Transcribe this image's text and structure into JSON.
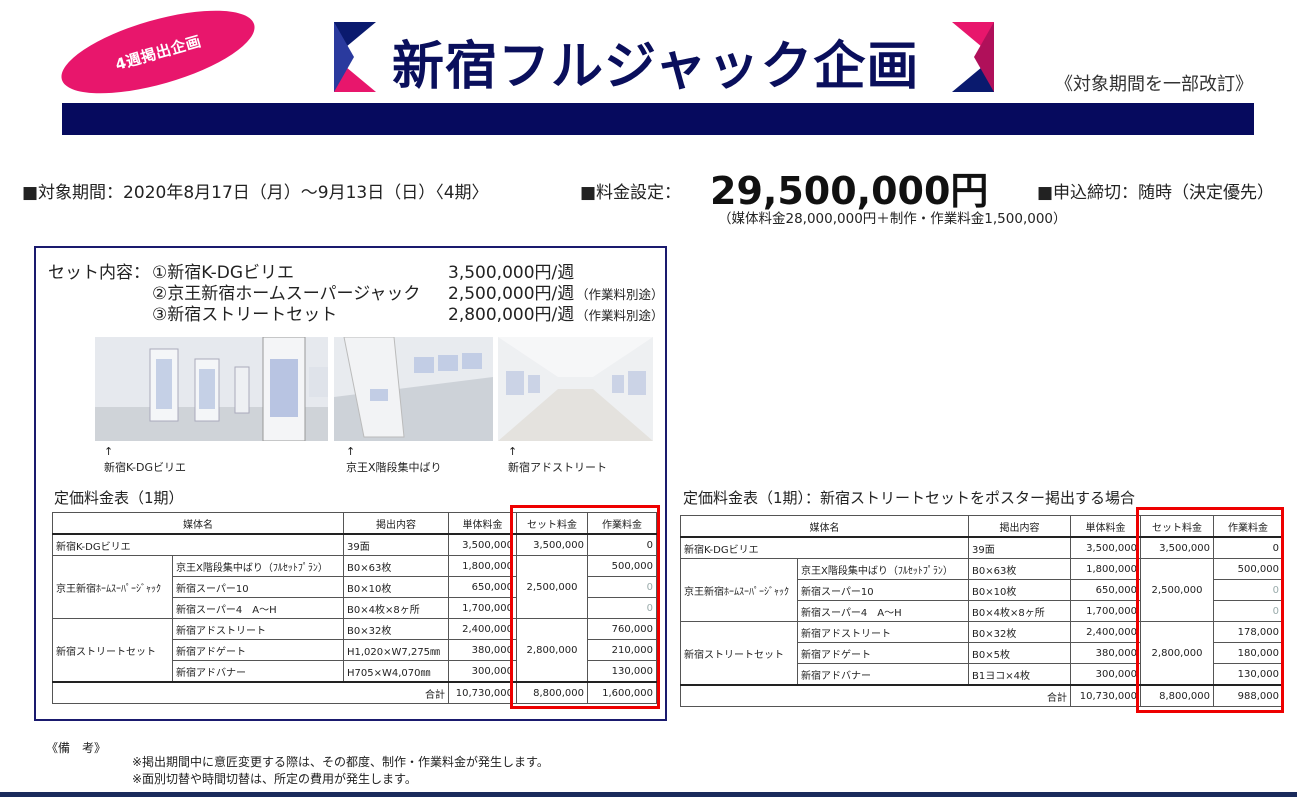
{
  "header": {
    "badge": "4週掲出企画",
    "title": "新宿フルジャック企画",
    "revision": "《対象期間を一部改訂》"
  },
  "info": {
    "period": "■対象期間：2020年8月17日（月）～9月13日（日）〈4期〉",
    "price_label": "■料金設定：",
    "price": "29,500,000円",
    "price_note": "（媒体料金28,000,000円＋制作・作業料金1,500,000）",
    "deadline": "■申込締切：随時（決定優先）"
  },
  "set": {
    "label": "セット内容：",
    "items": [
      {
        "name": "①新宿K-DGビリエ",
        "price": "3,500,000円/週",
        "note": ""
      },
      {
        "name": "②京王新宿ホームスーパージャック",
        "price": "2,500,000円/週",
        "note": "（作業料別途）"
      },
      {
        "name": "③新宿ストリートセット",
        "price": "2,800,000円/週",
        "note": "（作業料別途）"
      }
    ]
  },
  "photos": [
    {
      "caption": "新宿K-DGビリエ"
    },
    {
      "caption": "京王X階段集中ばり"
    },
    {
      "caption": "新宿アドストリート"
    }
  ],
  "arrow": "↑",
  "table1": {
    "title": "定価料金表（1期）",
    "headers": [
      "媒体名",
      "掲出内容",
      "単体料金",
      "セット料金",
      "作業料金"
    ],
    "rows": [
      {
        "group": "新宿K-DGビリエ",
        "sub": "",
        "content": "39面",
        "unit": "3,500,000",
        "set": "3,500,000",
        "work": "0"
      },
      {
        "group": "京王新宿ﾎｰﾑｽｰﾊﾟｰｼﾞｬｯｸ",
        "sub": "京王X階段集中ばり（ﾌﾙｾｯﾄﾌﾟﾗﾝ）",
        "content": "B0×63枚",
        "unit": "1,800,000",
        "set": "2,500,000",
        "work": "500,000"
      },
      {
        "sub": "新宿スーパー10",
        "content": "B0×10枚",
        "unit": "650,000",
        "work": "0"
      },
      {
        "sub": "新宿スーパー4　A～H",
        "content": "B0×4枚×8ヶ所",
        "unit": "1,700,000",
        "work": "0"
      },
      {
        "group": "新宿ストリートセット",
        "sub": "新宿アドストリート",
        "content": "B0×32枚",
        "unit": "2,400,000",
        "set": "2,800,000",
        "work": "760,000"
      },
      {
        "sub": "新宿アドゲート",
        "content": "H1,020×W7,275㎜",
        "unit": "380,000",
        "work": "210,000"
      },
      {
        "sub": "新宿アドバナー",
        "content": "H705×W4,070㎜",
        "unit": "300,000",
        "work": "130,000"
      }
    ],
    "total": {
      "label": "合計",
      "unit": "10,730,000",
      "set": "8,800,000",
      "work": "1,600,000"
    }
  },
  "table2": {
    "title": "定価料金表（1期）：新宿ストリートセットをポスター掲出する場合",
    "headers": [
      "媒体名",
      "掲出内容",
      "単体料金",
      "セット料金",
      "作業料金"
    ],
    "rows": [
      {
        "group": "新宿K-DGビリエ",
        "sub": "",
        "content": "39面",
        "unit": "3,500,000",
        "set": "3,500,000",
        "work": "0"
      },
      {
        "group": "京王新宿ﾎｰﾑｽｰﾊﾟｰｼﾞｬｯｸ",
        "sub": "京王X階段集中ばり（ﾌﾙｾｯﾄﾌﾟﾗﾝ）",
        "content": "B0×63枚",
        "unit": "1,800,000",
        "set": "2,500,000",
        "work": "500,000"
      },
      {
        "sub": "新宿スーパー10",
        "content": "B0×10枚",
        "unit": "650,000",
        "work": "0"
      },
      {
        "sub": "新宿スーパー4　A～H",
        "content": "B0×4枚×8ヶ所",
        "unit": "1,700,000",
        "work": "0"
      },
      {
        "group": "新宿ストリートセット",
        "sub": "新宿アドストリート",
        "content": "B0×32枚",
        "unit": "2,400,000",
        "set": "2,800,000",
        "work": "178,000"
      },
      {
        "sub": "新宿アドゲート",
        "content": "B0×5枚",
        "unit": "380,000",
        "work": "180,000"
      },
      {
        "sub": "新宿アドバナー",
        "content": "B1ヨコ×4枚",
        "unit": "300,000",
        "work": "130,000"
      }
    ],
    "total": {
      "label": "合計",
      "unit": "10,730,000",
      "set": "8,800,000",
      "work": "988,000"
    }
  },
  "remarks": {
    "title": "《備　考》",
    "lines": [
      "※掲出期間中に意匠変更する際は、その都度、制作・作業料金が発生します。",
      "※面別切替や時間切替は、所定の費用が発生します。"
    ]
  },
  "colors": {
    "navy": "#060a5e",
    "magenta": "#e8166c",
    "red": "#e00000"
  }
}
